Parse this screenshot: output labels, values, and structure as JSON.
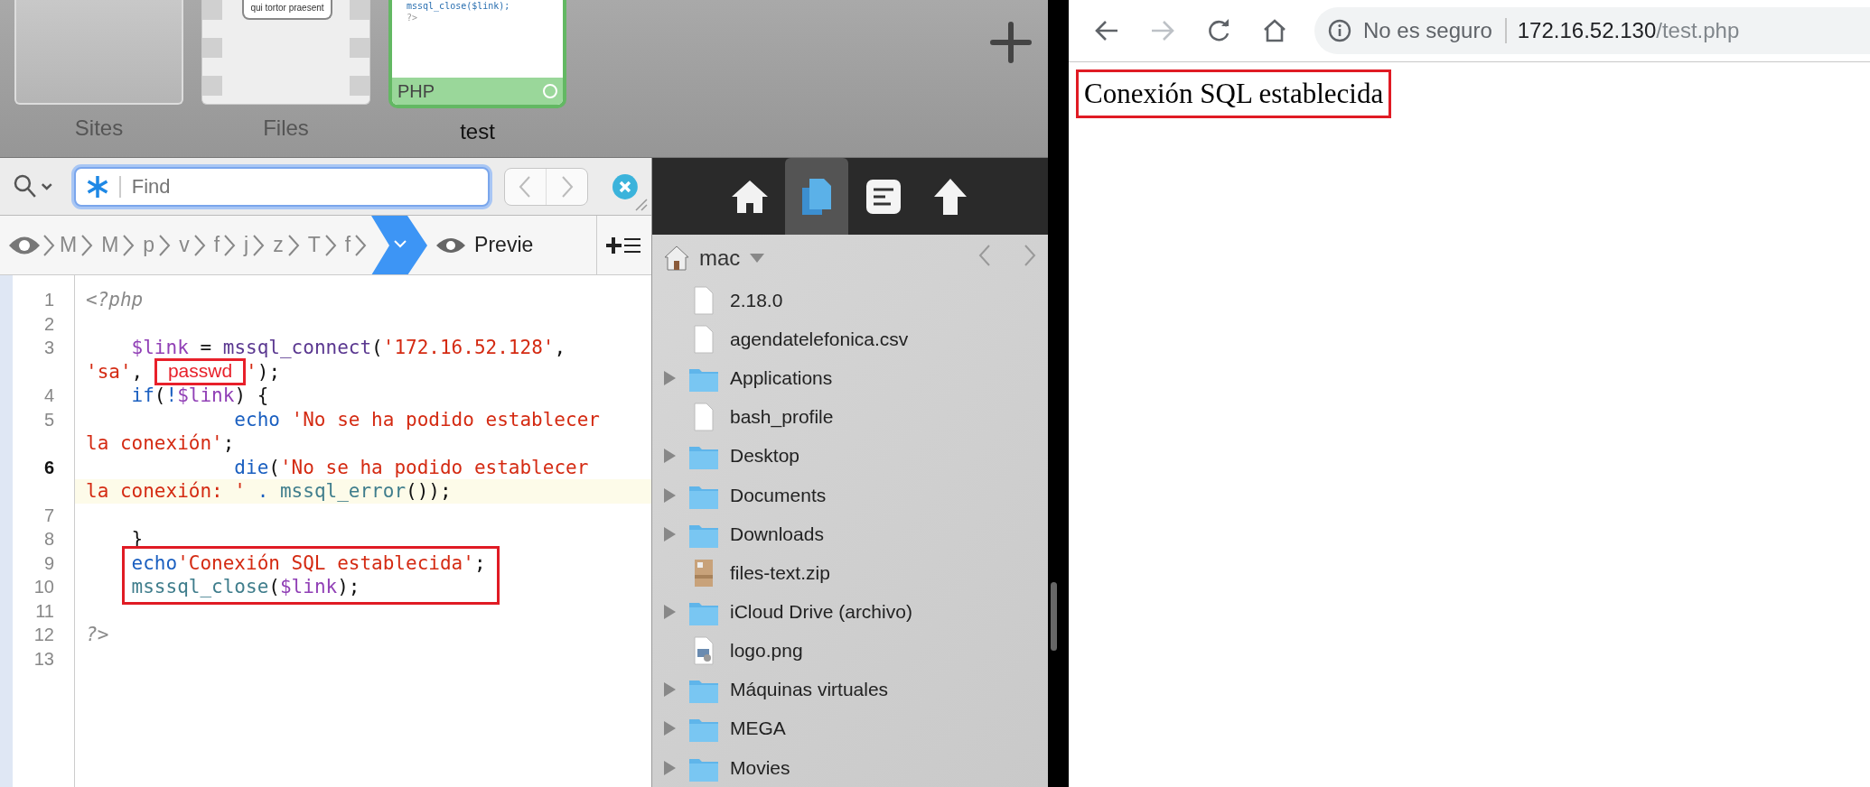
{
  "tab_strip": {
    "tabs": [
      {
        "label": "Sites",
        "kind": "blank",
        "selected": false
      },
      {
        "label": "Files",
        "kind": "document",
        "preview": [
          "qui tortor praesent"
        ],
        "selected": false
      },
      {
        "label": "test",
        "kind": "code",
        "badge": "PHP",
        "preview": [
          "mssql_close($link);",
          "?>"
        ],
        "selected": true
      }
    ]
  },
  "find_bar": {
    "placeholder": "Find"
  },
  "breadcrumbs": {
    "items": [
      "M",
      "M",
      "p",
      "v",
      "f",
      "j",
      "z",
      "T",
      "f"
    ],
    "preview_label": "Previe"
  },
  "editor": {
    "lines": [
      {
        "number": "1",
        "current": false,
        "boxed": false,
        "rows": [
          {
            "tokens": [
              {
                "kind": "tag",
                "text": "<?php"
              }
            ]
          }
        ]
      },
      {
        "number": "2",
        "current": false,
        "boxed": false
      },
      {
        "number": "3",
        "current": false,
        "boxed": false,
        "rows": [
          {
            "tokens": [
              {
                "kind": "var",
                "text": "    $link"
              },
              {
                "kind": "plain",
                "text": " = "
              },
              {
                "kind": "fn",
                "text": "mssql_connect"
              },
              {
                "kind": "plain",
                "text": "("
              },
              {
                "kind": "str",
                "text": "'172.16.52.128'"
              },
              {
                "kind": "plain",
                "text": ","
              }
            ]
          },
          {
            "tokens": [
              {
                "kind": "str",
                "text": "'sa'"
              },
              {
                "kind": "plain",
                "text": ", "
              },
              {
                "kind": "redacted",
                "text": "passwd"
              },
              {
                "kind": "str",
                "text": "'"
              },
              {
                "kind": "plain",
                "text": ");"
              }
            ]
          }
        ]
      },
      {
        "number": "4",
        "current": false,
        "boxed": false,
        "rows": [
          {
            "tokens": [
              {
                "kind": "kw",
                "text": "    if"
              },
              {
                "kind": "plain",
                "text": "("
              },
              {
                "kind": "op",
                "text": "!"
              },
              {
                "kind": "var",
                "text": "$link"
              },
              {
                "kind": "plain",
                "text": ") {"
              }
            ]
          }
        ]
      },
      {
        "number": "5",
        "current": false,
        "boxed": false,
        "rows": [
          {
            "tokens": [
              {
                "kind": "kw",
                "text": "             echo"
              },
              {
                "kind": "str",
                "text": " 'No se ha podido establecer"
              }
            ]
          },
          {
            "tokens": [
              {
                "kind": "str",
                "text": "la conexión'"
              },
              {
                "kind": "plain",
                "text": ";"
              }
            ]
          }
        ]
      },
      {
        "number": "6",
        "current": true,
        "boxed": false,
        "rows": [
          {
            "tokens": [
              {
                "kind": "kw",
                "text": "             die"
              },
              {
                "kind": "plain",
                "text": "("
              },
              {
                "kind": "str",
                "text": "'No se ha podido establecer"
              }
            ]
          },
          {
            "tokens": [
              {
                "kind": "str",
                "text": "la conexión: '"
              },
              {
                "kind": "op",
                "text": " . "
              },
              {
                "kind": "builtin",
                "text": "mssql_error"
              },
              {
                "kind": "plain",
                "text": "());"
              }
            ]
          }
        ]
      },
      {
        "number": "7",
        "current": false,
        "boxed": false
      },
      {
        "number": "8",
        "current": false,
        "boxed": false,
        "rows": [
          {
            "tokens": [
              {
                "kind": "plain",
                "text": "    }"
              }
            ]
          }
        ]
      },
      {
        "number": "9",
        "current": false,
        "boxed": true,
        "rows": [
          {
            "tokens": [
              {
                "kind": "kw",
                "text": "    echo"
              },
              {
                "kind": "str",
                "text": "'Conexión SQL establecida'"
              },
              {
                "kind": "plain",
                "text": ";"
              }
            ]
          }
        ]
      },
      {
        "number": "10",
        "current": false,
        "boxed": true,
        "rows": [
          {
            "tokens": [
              {
                "kind": "builtin",
                "text": "    msssql_close"
              },
              {
                "kind": "plain",
                "text": "("
              },
              {
                "kind": "var",
                "text": "$link"
              },
              {
                "kind": "plain",
                "text": ");"
              }
            ]
          }
        ]
      },
      {
        "number": "11",
        "current": false,
        "boxed": false
      },
      {
        "number": "12",
        "current": false,
        "boxed": false,
        "rows": [
          {
            "tokens": [
              {
                "kind": "tag",
                "text": "?>"
              }
            ]
          }
        ]
      },
      {
        "number": "13",
        "current": false,
        "boxed": false
      }
    ]
  },
  "file_browser": {
    "toolbar": [
      {
        "kind": "home",
        "selected": false
      },
      {
        "kind": "files",
        "selected": true
      },
      {
        "kind": "list",
        "selected": false
      },
      {
        "kind": "up",
        "selected": false
      }
    ],
    "location": "mac",
    "items": [
      {
        "name": "2.18.0",
        "kind": "file"
      },
      {
        "name": "agendatelefonica.csv",
        "kind": "file"
      },
      {
        "name": "Applications",
        "kind": "folder"
      },
      {
        "name": "bash_profile",
        "kind": "file"
      },
      {
        "name": "Desktop",
        "kind": "folder"
      },
      {
        "name": "Documents",
        "kind": "folder"
      },
      {
        "name": "Downloads",
        "kind": "folder"
      },
      {
        "name": "files-text.zip",
        "kind": "zip"
      },
      {
        "name": "iCloud Drive (archivo)",
        "kind": "folder"
      },
      {
        "name": "logo.png",
        "kind": "image"
      },
      {
        "name": "Máquinas virtuales",
        "kind": "folder"
      },
      {
        "name": "MEGA",
        "kind": "folder"
      },
      {
        "name": "Movies",
        "kind": "folder"
      }
    ]
  },
  "browser": {
    "security_label": "No es seguro",
    "url_host": "172.16.52.130",
    "url_path": "/test.php",
    "forward_disabled": true,
    "page_text": "Conexión SQL establecida",
    "page_text_boxed": true
  }
}
